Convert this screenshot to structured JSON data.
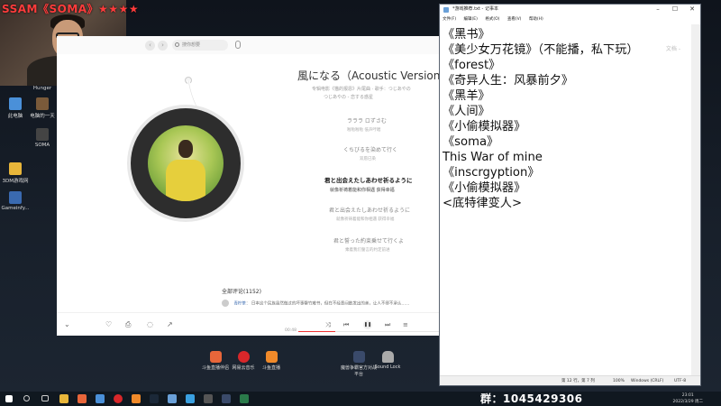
{
  "stream": {
    "title": "SSAM《SOMA》★★★★"
  },
  "desktop_icons": [
    {
      "label": "Hunger",
      "color": "#3a3a3a"
    },
    {
      "label": "此电脑",
      "color": "#4a90d9"
    },
    {
      "label": "电脑的一天",
      "color": "#7a5a3a"
    },
    {
      "label": "SOMA",
      "color": "#2a2a2a"
    },
    {
      "label": "3DM游戏网",
      "color": "#e8b63a"
    },
    {
      "label": "Gameinfy...",
      "color": "#3a6ab0"
    }
  ],
  "player": {
    "search_placeholder": "搜你想要",
    "song_title": "風になる（Acoustic Version)",
    "song_meta": "专辑电影《猫的报恩》片尾曲 · 歌手：つじあやの",
    "song_meta2": "つじあやの - 恋する惑星",
    "lyrics": [
      {
        "jp": "ラララ ロずさむ",
        "cn": "啦啦啦啦 低声哼唱",
        "active": false
      },
      {
        "jp": "くちびるを染めて行く",
        "cn": "双唇已染",
        "active": false
      },
      {
        "jp": "君と出会えたしあわせ祈るように",
        "cn": "就像祈祷着能和你相遇 获得幸福",
        "active": true
      },
      {
        "jp": "君と出会えたしあわせ祈るように",
        "cn": "就像祈祷着能和你相遇 获得幸福",
        "active": false
      },
      {
        "jp": "君と誓った約束乗せて行くよ",
        "cn": "乘着我们誓言的约定前进",
        "active": false
      }
    ],
    "comments_header": "全部评论(1152)",
    "comment_user": "青柠茶",
    "comment_text": "日本这个民族虽然做过的坏事罄竹难书，但在不经意间散发出的美，让人不得不承认……",
    "time_elapsed": "00:48"
  },
  "apps": [
    {
      "label": "斗鱼直播伴侣",
      "color": "#e8663a"
    },
    {
      "label": "网易云音乐",
      "color": "#d8272a"
    },
    {
      "label": "斗鱼直播",
      "color": "#f08a2a"
    },
    {
      "label": "魔兽争霸官方对战平台",
      "color": "#3a4a6a"
    },
    {
      "label": "Sound Lock",
      "color": "#aaaaaa"
    }
  ],
  "notepad": {
    "title": "*游戏推荐.txt - 记事本",
    "menu": [
      "文件(F)",
      "编辑(E)",
      "格式(O)",
      "查看(V)",
      "帮助(H)"
    ],
    "watermark": "文档 -",
    "lines": [
      "《黑书》",
      "《美少女万花镜》（不能播，私下玩）",
      "《forest》",
      "《奇异人生：风暴前夕》",
      "《黑羊》",
      "《人间》",
      "《小偷模拟器》",
      "《soma》",
      "This War of mine",
      "《inscrgyption》",
      "《小偷模拟器》",
      "<底特律变人>"
    ],
    "status": {
      "position": "第 12 行，第 7 列",
      "zoom": "100%",
      "line_ending": "Windows (CRLF)",
      "encoding": "UTF-8"
    }
  },
  "group": {
    "text": "群：1045429306"
  },
  "taskbar": {
    "time": "23:01",
    "date": "2022/3/29 周二"
  },
  "colors": {
    "accent_red": "#e33333",
    "desktop_bg": "#151c26"
  }
}
